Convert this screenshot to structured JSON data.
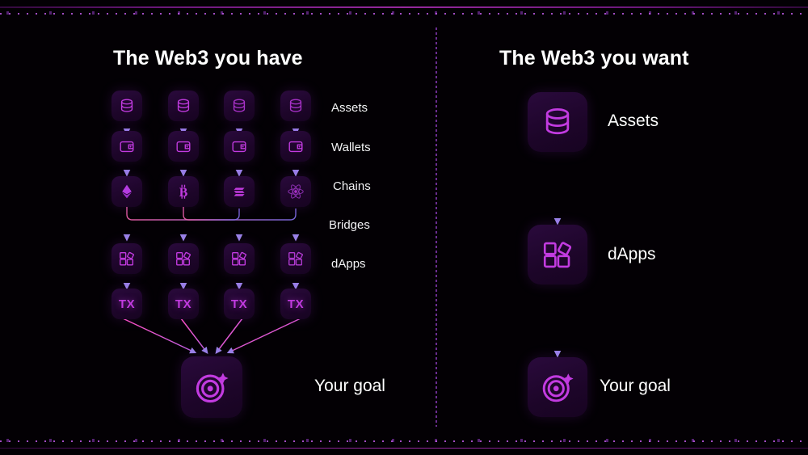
{
  "theme": {
    "background": "#030004",
    "tile_fill": "#2a0a3c",
    "accent_magenta": "#c23be0",
    "accent_violet": "#8b6fe0",
    "accent_pink": "#e85fa8",
    "text_primary": "#ffffff",
    "divider": "#8c3cbe"
  },
  "left_panel": {
    "title": "The Web3 you have",
    "row_labels": [
      {
        "key": "assets",
        "label": "Assets"
      },
      {
        "key": "wallets",
        "label": "Wallets"
      },
      {
        "key": "chains",
        "label": "Chains"
      },
      {
        "key": "bridges",
        "label": "Bridges"
      },
      {
        "key": "dapps",
        "label": "dApps"
      }
    ],
    "columns": [
      {
        "assets_icon": "coin-stack-icon",
        "wallet_icon": "wallet-icon",
        "chain_icon": "ethereum-icon",
        "chain_name": "Ethereum",
        "dapp_icon": "dapps-icon",
        "tx_label": "TX"
      },
      {
        "assets_icon": "coin-stack-icon",
        "wallet_icon": "wallet-icon",
        "chain_icon": "bitcoin-icon",
        "chain_name": "Bitcoin",
        "dapp_icon": "dapps-icon",
        "tx_label": "TX"
      },
      {
        "assets_icon": "coin-stack-icon",
        "wallet_icon": "wallet-icon",
        "chain_icon": "solana-icon",
        "chain_name": "Solana",
        "dapp_icon": "dapps-icon",
        "tx_label": "TX"
      },
      {
        "assets_icon": "coin-stack-icon",
        "wallet_icon": "wallet-icon",
        "chain_icon": "cosmos-icon",
        "chain_name": "Cosmos",
        "dapp_icon": "dapps-icon",
        "tx_label": "TX"
      }
    ],
    "goal": {
      "icon": "target-goal-icon",
      "label": "Your goal"
    }
  },
  "right_panel": {
    "title": "The Web3 you want",
    "steps": [
      {
        "key": "assets",
        "icon": "coin-stack-icon",
        "label": "Assets"
      },
      {
        "key": "dapps",
        "icon": "dapps-icon",
        "label": "dApps"
      },
      {
        "key": "goal",
        "icon": "target-goal-icon",
        "label": "Your goal"
      }
    ]
  }
}
